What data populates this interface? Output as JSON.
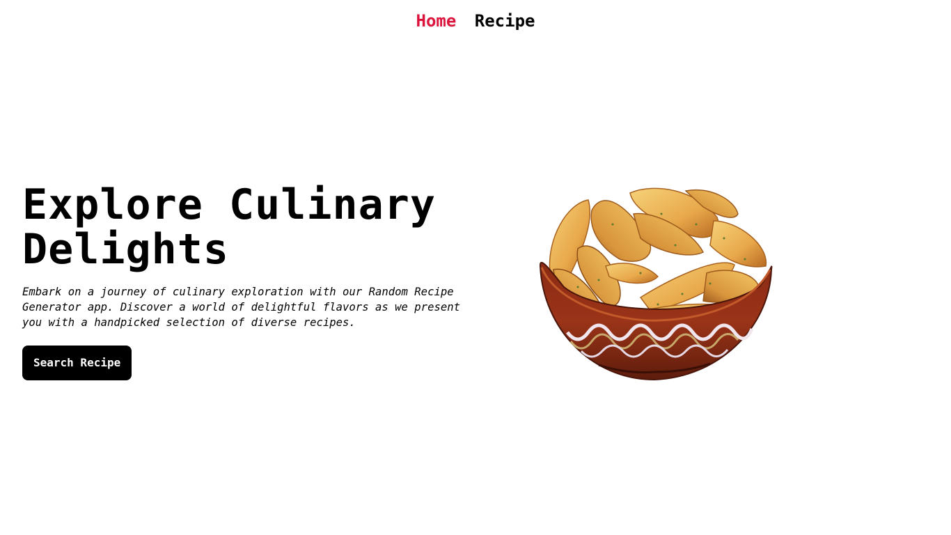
{
  "nav": {
    "home_label": "Home",
    "recipe_label": "Recipe",
    "home_color": "#dc143c"
  },
  "hero": {
    "title_line1": "Explore Culinary",
    "title_line2": "Delights",
    "description": "Embark on a journey of culinary exploration with our Random Recipe Generator app. Discover a world of delightful flavors as we present you with a handpicked selection of diverse recipes.",
    "button_label": "Search Recipe",
    "image_subject": "bowl-of-potato-wedges"
  }
}
